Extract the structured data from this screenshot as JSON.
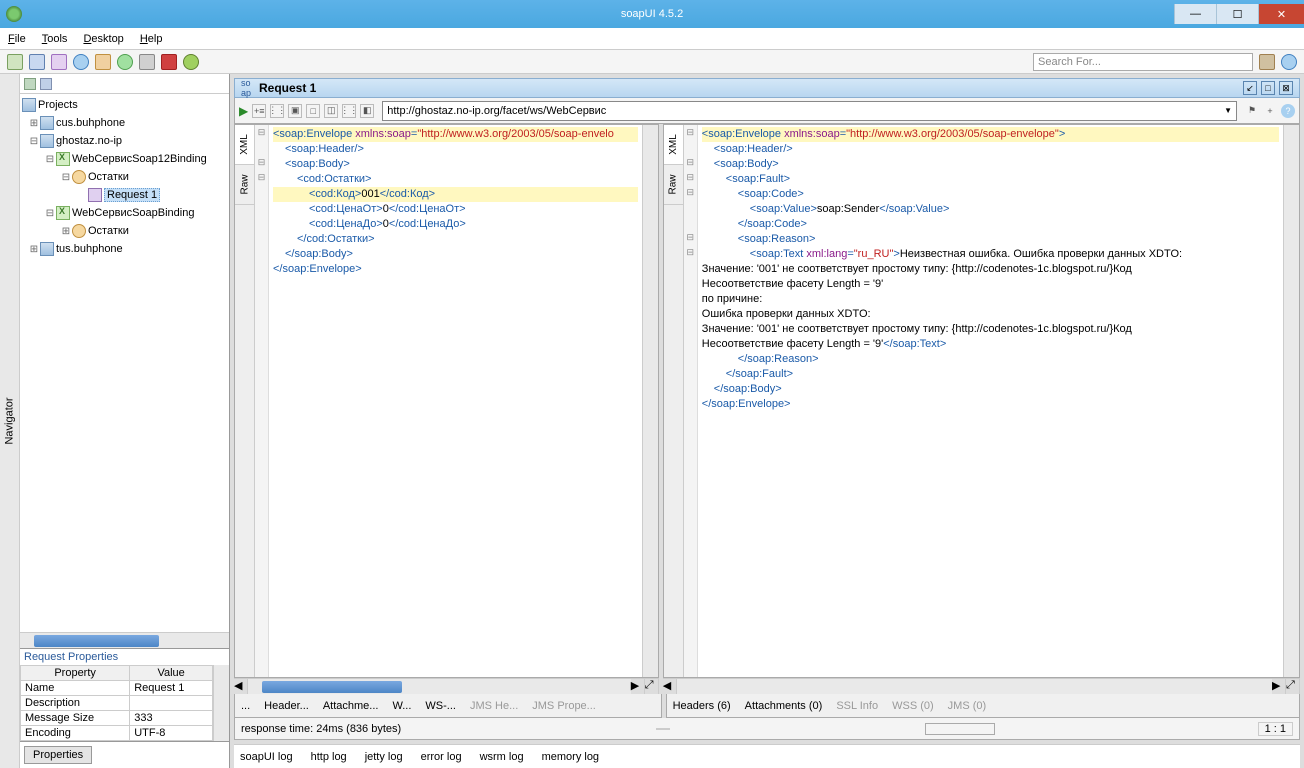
{
  "window": {
    "title": "soapUI 4.5.2"
  },
  "menu": {
    "file": "File",
    "tools": "Tools",
    "desktop": "Desktop",
    "help": "Help"
  },
  "search": {
    "placeholder": "Search For..."
  },
  "nav": {
    "label": "Navigator"
  },
  "tree": {
    "root": "Projects",
    "n0": "cus.buhphone",
    "n1": "ghostaz.no-ip",
    "n1a": "WebСервисSoap12Binding",
    "n1a1": "Остатки",
    "n1a1r": "Request 1",
    "n1b": "WebСервисSoapBinding",
    "n1b1": "Остатки",
    "n2": "tus.buhphone"
  },
  "props": {
    "title": "Request Properties",
    "h1": "Property",
    "h2": "Value",
    "r0k": "Name",
    "r0v": "Request 1",
    "r1k": "Description",
    "r1v": "",
    "r2k": "Message Size",
    "r2v": "333",
    "r3k": "Encoding",
    "r3v": "UTF-8",
    "btn": "Properties"
  },
  "req": {
    "title": "Request 1",
    "url": "http://ghostaz.no-ip.org/facet/ws/WebСервис",
    "sidetabs": {
      "xml": "XML",
      "raw": "Raw"
    }
  },
  "xmlLeft": {
    "l0a": "<soap:Envelope ",
    "l0b": "xmlns:soap",
    "l0c": "=",
    "l0d": "\"http://www.w3.org/2003/05/soap-envelo",
    "l1": "<soap:Header/>",
    "l2": "<soap:Body>",
    "l3": "<cod:Остатки>",
    "l4a": "<cod:Код>",
    "l4b": "001",
    "l4c": "</cod:Код>",
    "l5a": "<cod:ЦенаОт>",
    "l5b": "0",
    "l5c": "</cod:ЦенаОт>",
    "l6a": "<cod:ЦенаДо>",
    "l6b": "0",
    "l6c": "</cod:ЦенаДо>",
    "l7": "</cod:Остатки>",
    "l8": "</soap:Body>",
    "l9": "</soap:Envelope>"
  },
  "xmlRight": {
    "l0a": "<soap:Envelope ",
    "l0b": "xmlns:soap",
    "l0c": "=",
    "l0d": "\"http://www.w3.org/2003/05/soap-envelope\"",
    "l0e": ">",
    "l1": "<soap:Header/>",
    "l2": "<soap:Body>",
    "l3": "<soap:Fault>",
    "l4": "<soap:Code>",
    "l5a": "<soap:Value>",
    "l5b": "soap:Sender",
    "l5c": "</soap:Value>",
    "l6": "</soap:Code>",
    "l7": "<soap:Reason>",
    "l8a": "<soap:Text ",
    "l8b": "xml:lang",
    "l8c": "=",
    "l8d": "\"ru_RU\"",
    "l8e": ">",
    "l8f": "Неизвестная ошибка. Ошибка проверки данных XDTO:",
    "l9": "Значение: '001' не соответствует простому типу: {http://codenotes-1c.blogspot.ru/}Код",
    "l10": "Несоответствие фасету Length = '9'",
    "l11": "по причине:",
    "l12": "Ошибка проверки данных XDTO:",
    "l13": "Значение: '001' не соответствует простому типу: {http://codenotes-1c.blogspot.ru/}Код",
    "l14a": "Несоответствие фасету Length = '9'",
    "l14b": "</soap:Text>",
    "l15": "</soap:Reason>",
    "l16": "</soap:Fault>",
    "l17": "</soap:Body>",
    "l18": "</soap:Envelope>"
  },
  "btabsL": {
    "t0": "...",
    "t1": "Header...",
    "t2": "Attachme...",
    "t3": "W...",
    "t4": "WS-...",
    "t5": "JMS He...",
    "t6": "JMS Prope..."
  },
  "btabsR": {
    "t0": "Headers (6)",
    "t1": "Attachments (0)",
    "t2": "SSL Info",
    "t3": "WSS (0)",
    "t4": "JMS (0)"
  },
  "status": {
    "text": "response time: 24ms (836 bytes)",
    "ratio": "1 : 1"
  },
  "logs": {
    "l0": "soapUI log",
    "l1": "http log",
    "l2": "jetty log",
    "l3": "error log",
    "l4": "wsrm log",
    "l5": "memory log"
  }
}
